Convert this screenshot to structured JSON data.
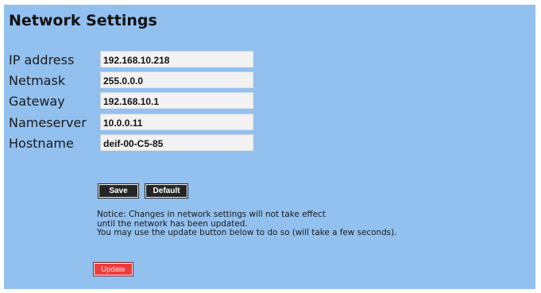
{
  "page": {
    "title": "Network Settings"
  },
  "fields": [
    {
      "label": "IP address",
      "value": "192.168.10.218"
    },
    {
      "label": "Netmask",
      "value": "255.0.0.0"
    },
    {
      "label": "Gateway",
      "value": "192.168.10.1"
    },
    {
      "label": "Nameserver",
      "value": "10.0.0.11"
    },
    {
      "label": "Hostname",
      "value": "deif-00-C5-85"
    }
  ],
  "buttons": {
    "save_label": "Save",
    "default_label": "Default",
    "update_label": "Update"
  },
  "notice": {
    "line1": "Notice: Changes in network settings will not take effect",
    "line2": "until the network has been updated.",
    "line3": "You may use the update button below to do so (will take a few seconds)."
  },
  "colors": {
    "panel_background": "#92c0ef",
    "button_background": "#262626",
    "update_button_background": "#ef3b3b"
  }
}
